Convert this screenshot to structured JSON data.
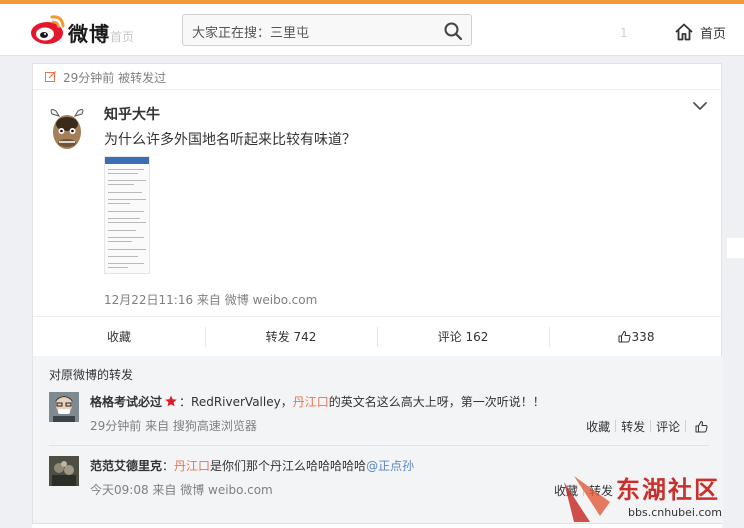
{
  "header": {
    "logo_text": "微博",
    "ghost_text": "首页",
    "search": {
      "value": "大家正在搜：三里屯"
    },
    "like_ghost": "1",
    "home_label": "首页"
  },
  "post": {
    "repost_note": "29分钟前 被转发过",
    "author": "知乎大牛",
    "text": "为什么许多外国地名听起来比较有味道？",
    "meta": "12月22日11:16 来自 微博 weibo.com",
    "actions": {
      "collect": "收藏",
      "repost": "转发 742",
      "comment": "评论 162",
      "like": "338"
    }
  },
  "comments": {
    "title": "对原微博的转发",
    "items": [
      {
        "user": "格格考试必过",
        "sep": "：",
        "pre": "RedRiverValley，",
        "link": "丹江口",
        "post": "的英文名这么高大上呀，第一次听说！！",
        "meta": "29分钟前 来自 搜狗高速浏览器",
        "collect": "收藏",
        "repost": "转发",
        "comment": "评论"
      },
      {
        "user": "范范艾德里克",
        "sep": "：",
        "link": "丹江口",
        "post": "是你们那个丹江么哈哈哈哈哈",
        "mention": "@正点孙",
        "meta": "今天09:08 来自 微博 weibo.com",
        "collect": "收藏",
        "repost": "转发"
      }
    ]
  },
  "watermark": {
    "title": "东湖社区",
    "url": "bbs.cnhubei.com"
  },
  "colors": {
    "accent": "#eb7350",
    "mention": "#5b86c5",
    "weibo_red": "#e6162d",
    "watermark": "#c9302c"
  },
  "icons": [
    "weibo-logo-icon",
    "search-icon",
    "home-icon",
    "edit-icon",
    "chevron-down-icon",
    "thumb-up-icon",
    "star-icon"
  ]
}
